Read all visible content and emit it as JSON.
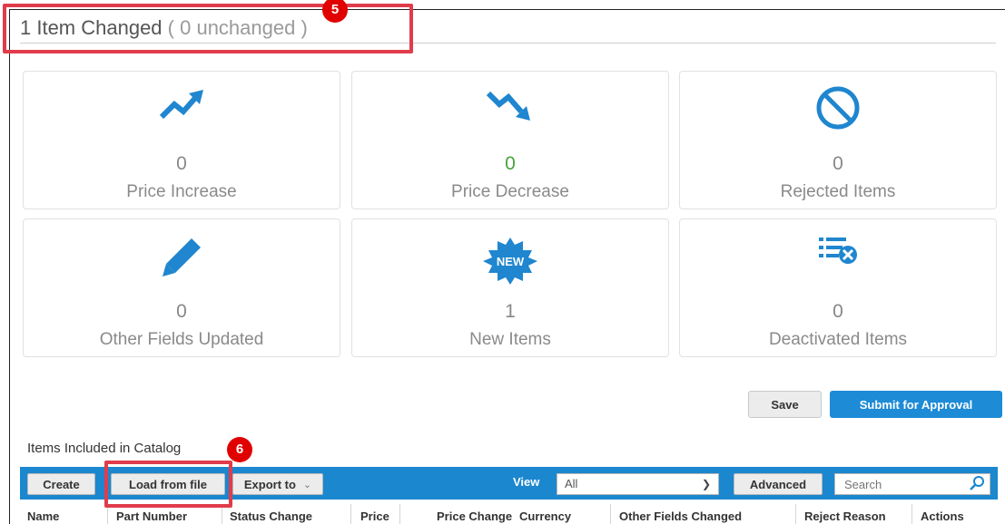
{
  "header": {
    "title": "1 Item Changed",
    "subtitle": "( 0 unchanged )"
  },
  "callouts": [
    "5",
    "6"
  ],
  "cards": [
    {
      "icon": "trend-up-icon",
      "count": "0",
      "label": "Price Increase"
    },
    {
      "icon": "trend-down-icon",
      "count": "0",
      "label": "Price Decrease"
    },
    {
      "icon": "prohibited-icon",
      "count": "0",
      "label": "Rejected Items"
    },
    {
      "icon": "pencil-icon",
      "count": "0",
      "label": "Other Fields Updated"
    },
    {
      "icon": "new-badge-icon",
      "count": "1",
      "label": "New Items",
      "badge_text": "NEW"
    },
    {
      "icon": "list-remove-icon",
      "count": "0",
      "label": "Deactivated Items"
    }
  ],
  "actions": {
    "save_label": "Save",
    "submit_label": "Submit for Approval"
  },
  "catalog": {
    "section_title": "Items Included in Catalog",
    "toolbar": {
      "create_label": "Create",
      "load_label": "Load from file",
      "export_label": "Export to",
      "view_label": "View",
      "view_selected": "All",
      "advanced_label": "Advanced",
      "search_placeholder": "Search"
    },
    "columns": [
      "Name",
      "Part Number",
      "Status Change",
      "Price",
      "Price Change",
      "Currency",
      "Other Fields Changed",
      "Reject Reason",
      "Actions"
    ]
  },
  "colors": {
    "accent": "#1b87cf",
    "icon_blue": "#1f86cf",
    "positive_green": "#49a33d",
    "callout_red": "#e03c4b"
  }
}
